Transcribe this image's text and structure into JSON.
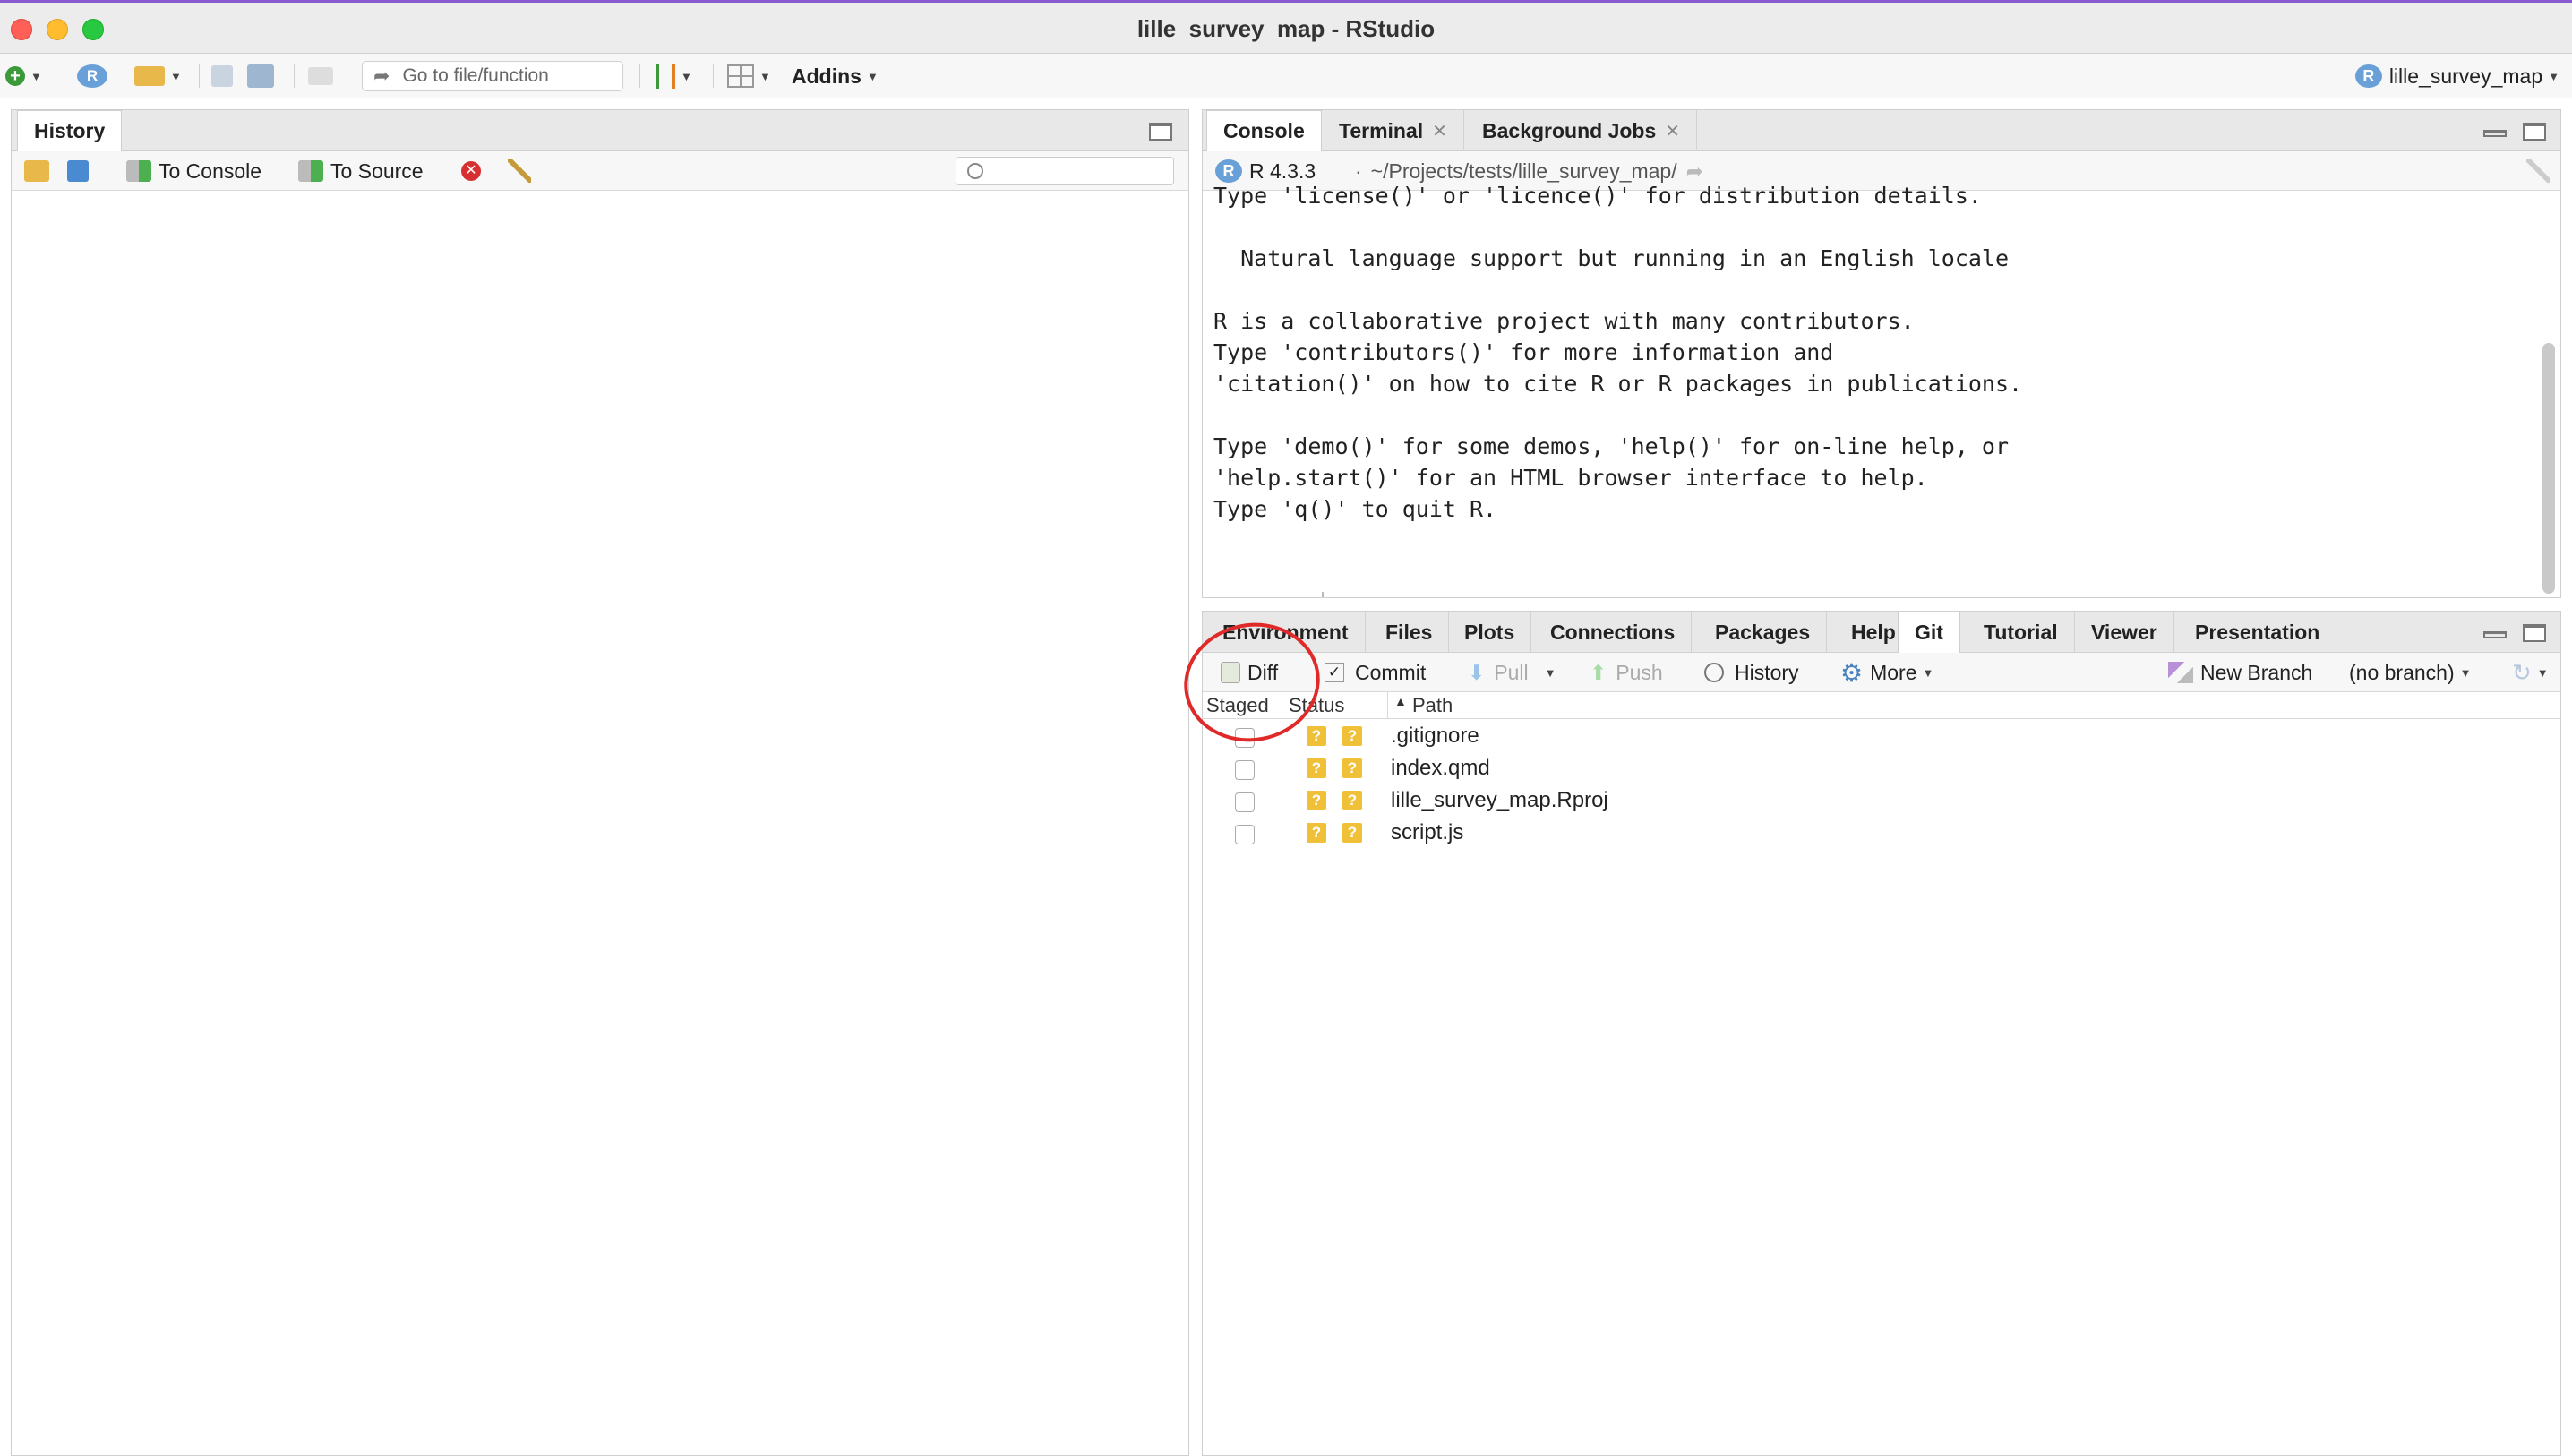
{
  "window": {
    "title": "lille_survey_map - RStudio"
  },
  "toolbar": {
    "goto_placeholder": "Go to file/function",
    "addins_label": "Addins",
    "project_label": "lille_survey_map",
    "project_icon": "R"
  },
  "history_pane": {
    "tab_label": "History",
    "to_console_label": "To Console",
    "to_source_label": "To Source",
    "search_placeholder": ""
  },
  "console_pane": {
    "tabs": [
      {
        "label": "Console",
        "closable": false
      },
      {
        "label": "Terminal",
        "closable": true
      },
      {
        "label": "Background Jobs",
        "closable": true
      }
    ],
    "r_version": "R 4.3.3",
    "separator": "·",
    "working_dir": "~/Projects/tests/lille_survey_map/",
    "lines": [
      "Type 'license()' or 'licence()' for distribution details.",
      "",
      "  Natural language support but running in an English locale",
      "",
      "R is a collaborative project with many contributors.",
      "Type 'contributors()' for more information and",
      "'citation()' on how to cite R or R packages in publications.",
      "",
      "Type 'demo()' for some demos, 'help()' for on-line help, or",
      "'help.start()' for an HTML browser interface to help.",
      "Type 'q()' to quit R.",
      ""
    ],
    "prompt": ">"
  },
  "git_pane": {
    "tabs": [
      "Environment",
      "Files",
      "Plots",
      "Connections",
      "Packages",
      "Help",
      "Git",
      "Tutorial",
      "Viewer",
      "Presentation"
    ],
    "active_tab": "Git",
    "toolbar": {
      "diff": "Diff",
      "commit": "Commit",
      "pull": "Pull",
      "push": "Push",
      "history": "History",
      "more": "More",
      "new_branch": "New Branch",
      "branch": "(no branch)"
    },
    "columns": {
      "staged": "Staged",
      "status": "Status",
      "path": "Path"
    },
    "files": [
      {
        "path": ".gitignore",
        "status": "?"
      },
      {
        "path": "index.qmd",
        "status": "?"
      },
      {
        "path": "lille_survey_map.Rproj",
        "status": "?"
      },
      {
        "path": "script.js",
        "status": "?"
      }
    ]
  },
  "colors": {
    "annotation": "#e02a2a",
    "untracked_badge": "#f0c038",
    "prompt": "#2a50b8"
  }
}
